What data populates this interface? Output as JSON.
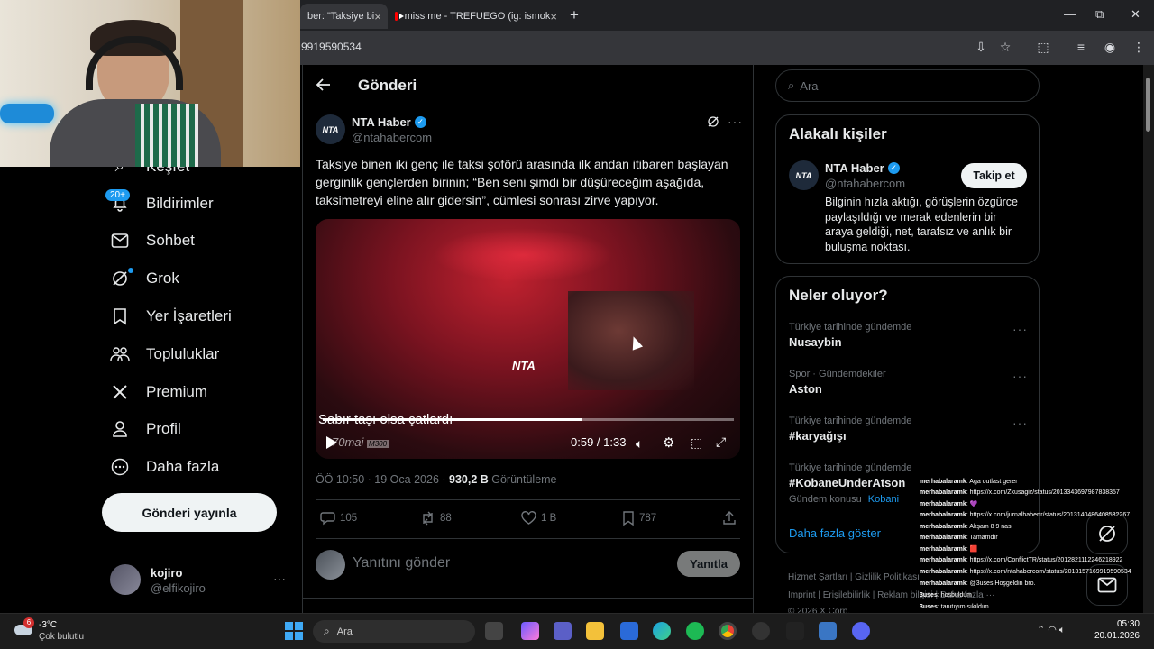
{
  "browser": {
    "tabs": [
      {
        "title": "ber: \"Taksiye bi",
        "close": "×"
      },
      {
        "title": "miss me - TREFUEGO (ig: ismok",
        "close": "×"
      }
    ],
    "new_tab": "+",
    "url": "9919590534",
    "window_controls": {
      "minimize": "—",
      "maximize": "⧉",
      "close": "✕"
    }
  },
  "sidebar": {
    "items": [
      {
        "label": "Keşfet",
        "icon": "search-icon"
      },
      {
        "label": "Bildirimler",
        "icon": "bell-icon",
        "badge": "20+"
      },
      {
        "label": "Sohbet",
        "icon": "mail-icon"
      },
      {
        "label": "Grok",
        "icon": "grok-icon"
      },
      {
        "label": "Yer İşaretleri",
        "icon": "bookmark-icon"
      },
      {
        "label": "Topluluklar",
        "icon": "communities-icon"
      },
      {
        "label": "Premium",
        "icon": "x-logo-icon"
      },
      {
        "label": "Profil",
        "icon": "profile-icon"
      },
      {
        "label": "Daha fazla",
        "icon": "more-circle-icon"
      }
    ],
    "post_button": "Gönderi yayınla",
    "account": {
      "name": "kojiro",
      "handle": "@elfikojiro",
      "more": "···"
    }
  },
  "post": {
    "header_title": "Gönderi",
    "author": {
      "name": "NTA Haber",
      "handle": "@ntahabercom",
      "avatar_text": "NTA"
    },
    "text": "Taksiye binen iki genç ile taksi şoförü arasında ilk andan itibaren başlayan gerginlik gençlerden birinin; “Ben seni şimdi bir düşüreceğim aşağıda, taksimetreyi eline alır gidersin”, cümlesi sonrası zirve yapıyor.",
    "video": {
      "caption": "Sabır taşı olsa çatlardı",
      "watermark": "NTA",
      "brand": "70mai",
      "model": "M300",
      "time": "0:59 / 1:33",
      "progress": 0.63
    },
    "timestamp": "ÖÖ 10:50 · 19 Oca 2026 · ",
    "views_count": "930,2 B",
    "views_label": " Görüntüleme",
    "stats": {
      "replies": "105",
      "reposts": "88",
      "likes": "1 B",
      "bookmarks": "787"
    },
    "reply_placeholder": "Yanıtını gönder",
    "reply_button": "Yanıtla"
  },
  "right": {
    "search_placeholder": "Ara",
    "related": {
      "title": "Alakalı kişiler",
      "name": "NTA Haber",
      "handle": "@ntahabercom",
      "follow": "Takip et",
      "bio": "Bilginin hızla aktığı, görüşlerin özgürce paylaşıldığı ve merak edenlerin bir araya geldiği, net, tarafsız ve anlık bir buluşma noktası."
    },
    "trends": {
      "title": "Neler oluyor?",
      "items": [
        {
          "meta": "Türkiye tarihinde gündemde",
          "name": "Nusaybin"
        },
        {
          "meta": "Spor · Gündemdekiler",
          "name": "Aston"
        },
        {
          "meta": "Türkiye tarihinde gündemde",
          "name": "#karyağışı"
        },
        {
          "meta": "Türkiye tarihinde gündemde",
          "name": "#KobaneUnderAtson",
          "sub_label": "Gündem konusu",
          "sub_link": "Kobani"
        }
      ],
      "show_more": "Daha fazla göster"
    },
    "footer": {
      "line1": "Hizmet Şartları  |  Gizlilik Politikası",
      "line2": "Imprint  |  Erişilebilirlik  |  Reklam bilgisi  |  Daha fazla ···",
      "line3": "© 2026 X Corp."
    }
  },
  "chat_overlay": [
    {
      "user": "merhabalaramk",
      "msg": ": Aga outlast gerer"
    },
    {
      "user": "merhabalaramk",
      "msg": ": https://x.com/Zkusagiz/status/2013343697987838357"
    },
    {
      "user": "merhabalaramk",
      "msg": ": 💜"
    },
    {
      "user": "merhabalaramk",
      "msg": ": https://x.com/jurnalhabertr/status/2013140486408532267"
    },
    {
      "user": "merhabalaramk",
      "msg": ": Akşam 8 9 nası"
    },
    {
      "user": "merhabalaramk",
      "msg": ": Tamamdır"
    },
    {
      "user": "merhabalaramk",
      "msg": ": 🟥"
    },
    {
      "user": "merhabalaramk",
      "msg": ": https://x.com/ConflictTR/status/2012821112246218922"
    },
    {
      "user": "merhabalaramk",
      "msg": ": https://x.com/ntahabercom/status/2013157169919590534"
    },
    {
      "user": "merhabalaramk",
      "msg": ": @3uses Hoşgeldin bro."
    },
    {
      "user": "3uses",
      "msg": ": hosbuldum"
    },
    {
      "user": "3uses",
      "msg": ": tanıtıyım sıkıldım"
    }
  ],
  "taskbar": {
    "weather_temp": "-3°C",
    "weather_desc": "Çok bulutlu",
    "weather_badge": "6",
    "search": "Ara",
    "time": "05:30",
    "date": "20.01.2026"
  },
  "colors": {
    "accent": "#1d9bf0",
    "background": "#000000",
    "border": "#2f3336",
    "muted": "#71767b"
  }
}
